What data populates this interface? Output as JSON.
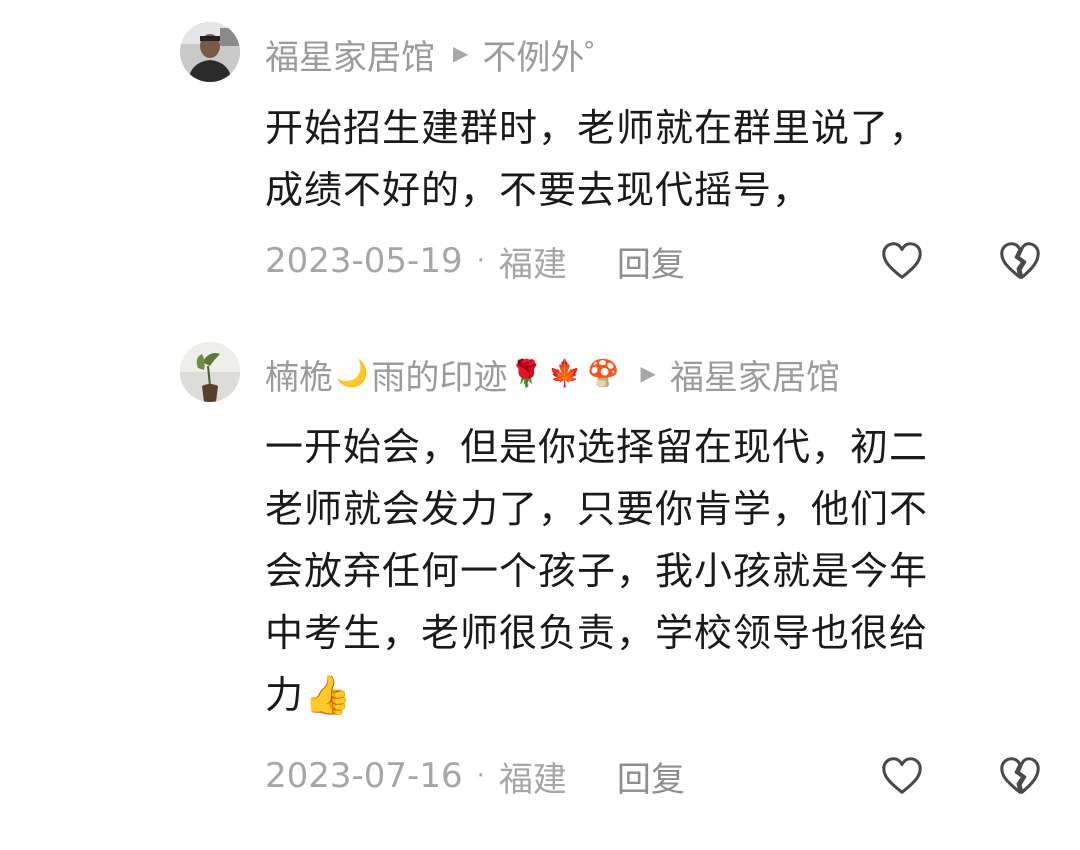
{
  "comments": [
    {
      "username": "福星家居馆",
      "reply_to": "不例外゜",
      "username_decorations": [],
      "text_lines": [
        "开始招生建群时，老师就在群里说了，",
        "成绩不好的，不要去现代摇号，"
      ],
      "date": "2023-05-19",
      "location": "福建",
      "reply_label": "回复",
      "avatar_icon": "person-photo-avatar"
    },
    {
      "username": "楠桅",
      "username_middle": "雨的印迹",
      "username_decorations": [
        "🌙",
        "🌹",
        "🍁",
        "🍄"
      ],
      "reply_to": "福星家居馆",
      "text_lines": [
        "一开始会，但是你选择留在现代，初二",
        "老师就会发力了，只要你肯学，他们不",
        "会放弃任何一个孩子，我小孩就是今年",
        "中考生，老师很负责，学校领导也很给",
        "力👍"
      ],
      "date": "2023-07-16",
      "location": "福建",
      "reply_label": "回复",
      "avatar_icon": "plant-vase-avatar"
    }
  ],
  "icons": {
    "like": "heart-outline-icon",
    "dislike": "broken-heart-icon",
    "reply_arrow": "play-triangle-icon"
  },
  "colors": {
    "meta_gray": "#9b9b9b",
    "text": "#1a1a1a",
    "icon": "#4a4a4a"
  }
}
